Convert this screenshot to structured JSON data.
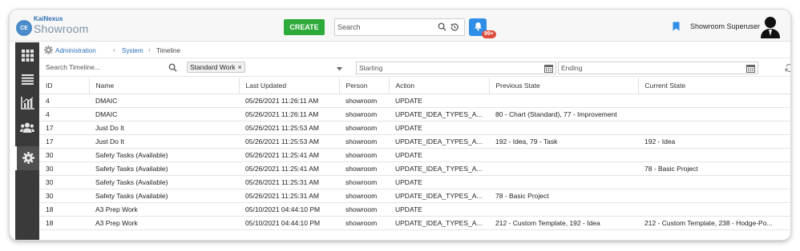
{
  "app": {
    "logo_initials": "CE",
    "logo_brand": "KaiNexus",
    "logo_product": "Showroom"
  },
  "header": {
    "create_label": "CREATE",
    "search_placeholder": "Search",
    "notification_count": "99+",
    "user_name": "Showroom Superuser"
  },
  "sidebar": {
    "items": [
      {
        "icon": "grid-icon"
      },
      {
        "icon": "list-icon"
      },
      {
        "icon": "chart-icon"
      },
      {
        "icon": "people-icon"
      },
      {
        "icon": "gear-icon",
        "active": true
      }
    ]
  },
  "breadcrumb": {
    "items": [
      "Administration",
      "System",
      "Timeline"
    ]
  },
  "filters": {
    "search_placeholder": "Search Timeline...",
    "tag": "Standard Work",
    "starting_placeholder": "Starting",
    "ending_placeholder": "Ending"
  },
  "table": {
    "columns": [
      "ID",
      "Name",
      "Last Updated",
      "Person",
      "Action",
      "Previous State",
      "Current State"
    ],
    "rows": [
      [
        "4",
        "DMAIC",
        "05/26/2021 11:26:11 AM",
        "showroom",
        "UPDATE",
        "",
        ""
      ],
      [
        "4",
        "DMAIC",
        "05/26/2021 11:26:11 AM",
        "showroom",
        "UPDATE_IDEA_TYPES_A...",
        "80 - Chart (Standard), 77 - Improvement",
        ""
      ],
      [
        "17",
        "Just Do It",
        "05/26/2021 11:25:53 AM",
        "showroom",
        "UPDATE",
        "",
        ""
      ],
      [
        "17",
        "Just Do It",
        "05/26/2021 11:25:53 AM",
        "showroom",
        "UPDATE_IDEA_TYPES_A...",
        "192 - Idea, 79 - Task",
        "192 - Idea"
      ],
      [
        "30",
        "Safety Tasks (Available)",
        "05/26/2021 11:25:41 AM",
        "showroom",
        "UPDATE",
        "",
        ""
      ],
      [
        "30",
        "Safety Tasks (Available)",
        "05/26/2021 11:25:41 AM",
        "showroom",
        "UPDATE_IDEA_TYPES_A...",
        "",
        "78 - Basic Project"
      ],
      [
        "30",
        "Safety Tasks (Available)",
        "05/26/2021 11:25:31 AM",
        "showroom",
        "UPDATE",
        "",
        ""
      ],
      [
        "30",
        "Safety Tasks (Available)",
        "05/26/2021 11:25:31 AM",
        "showroom",
        "UPDATE_IDEA_TYPES_A...",
        "78 - Basic Project",
        ""
      ],
      [
        "18",
        "A3 Prep Work",
        "05/10/2021 04:44:10 PM",
        "showroom",
        "UPDATE",
        "",
        ""
      ],
      [
        "18",
        "A3 Prep Work",
        "05/10/2021 04:44:10 PM",
        "showroom",
        "UPDATE_IDEA_TYPES_A...",
        "212 - Custom Template, 192 - Idea",
        "212 - Custom Template, 238 - Hodge-Po..."
      ]
    ]
  },
  "colors": {
    "create": "#2eaa3a",
    "bell": "#2f8ee6",
    "badge": "#e04a3c",
    "sidebar": "#3a3a3a",
    "link": "#2b6fb8"
  }
}
